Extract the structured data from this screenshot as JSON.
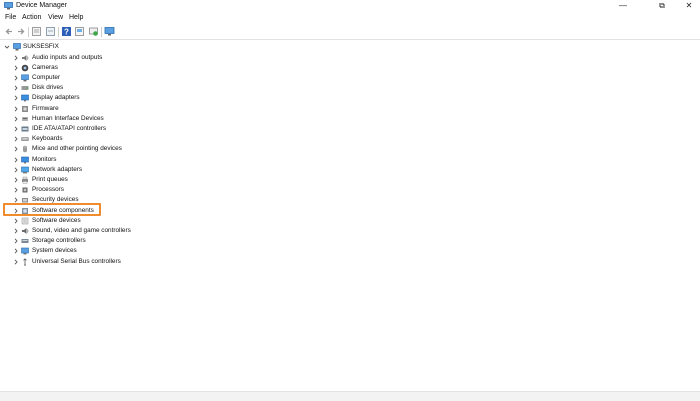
{
  "window": {
    "title": "Device Manager",
    "minimize": "—",
    "maximize": "⧉",
    "close": "✕"
  },
  "menu": [
    "File",
    "Action",
    "View",
    "Help"
  ],
  "toolbar": {
    "buttons": [
      "back-icon",
      "forward-icon",
      "properties-icon",
      "update-driver-icon",
      "help-icon",
      "show-hidden-icon",
      "scan-hardware-icon",
      "monitor-icon"
    ]
  },
  "tree": {
    "root": "SUKSESFIX",
    "selected_index": 11,
    "highlight_color": "#f08c2b",
    "items": [
      {
        "label": "Audio inputs and outputs",
        "icon": "speaker-icon"
      },
      {
        "label": "Cameras",
        "icon": "camera-icon"
      },
      {
        "label": "Computer",
        "icon": "computer-icon"
      },
      {
        "label": "Disk drives",
        "icon": "disk-icon"
      },
      {
        "label": "Display adapters",
        "icon": "display-icon"
      },
      {
        "label": "Firmware",
        "icon": "firmware-icon"
      },
      {
        "label": "Human Interface Devices",
        "icon": "hid-icon"
      },
      {
        "label": "IDE ATA/ATAPI controllers",
        "icon": "ide-icon"
      },
      {
        "label": "Keyboards",
        "icon": "keyboard-icon"
      },
      {
        "label": "Mice and other pointing devices",
        "icon": "mouse-icon"
      },
      {
        "label": "Monitors",
        "icon": "monitor-icon"
      },
      {
        "label": "Network adapters",
        "icon": "network-icon"
      },
      {
        "label": "Print queues",
        "icon": "printer-icon"
      },
      {
        "label": "Processors",
        "icon": "processor-icon"
      },
      {
        "label": "Security devices",
        "icon": "security-icon"
      },
      {
        "label": "Software components",
        "icon": "software-component-icon"
      },
      {
        "label": "Software devices",
        "icon": "software-device-icon"
      },
      {
        "label": "Sound, video and game controllers",
        "icon": "sound-icon"
      },
      {
        "label": "Storage controllers",
        "icon": "storage-icon"
      },
      {
        "label": "System devices",
        "icon": "system-icon"
      },
      {
        "label": "Universal Serial Bus controllers",
        "icon": "usb-icon"
      }
    ]
  }
}
